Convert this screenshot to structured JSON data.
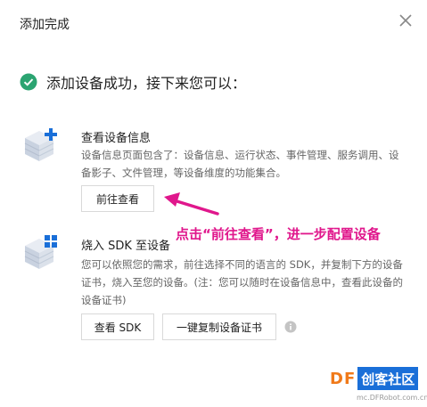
{
  "dialog": {
    "title": "添加完成",
    "success_message": "添加设备成功，接下来您可以："
  },
  "section_view": {
    "title": "查看设备信息",
    "description": "设备信息页面包含了：设备信息、运行状态、事件管理、服务调用、设备影子、文件管理，等设备维度的功能集合。",
    "button_label": "前往查看"
  },
  "section_sdk": {
    "title": "烧入 SDK 至设备",
    "description": "您可以依照您的需求，前往选择不同的语言的 SDK，并复制下方的设备证书，烧入至您的设备。(注：您可以随时在设备信息中，查看此设备的设备证书)",
    "view_sdk_label": "查看 SDK",
    "copy_cert_label": "一键复制设备证书"
  },
  "annotation": {
    "text": "点击“前往查看”，进一步配置设备"
  },
  "watermark": {
    "df": "DF",
    "box": "创客社区",
    "url": "mc.DFRobot.com.cn"
  },
  "colors": {
    "success_green": "#2ba471",
    "annotation_magenta": "#e0178c",
    "icon_blue": "#1a6fd8"
  }
}
